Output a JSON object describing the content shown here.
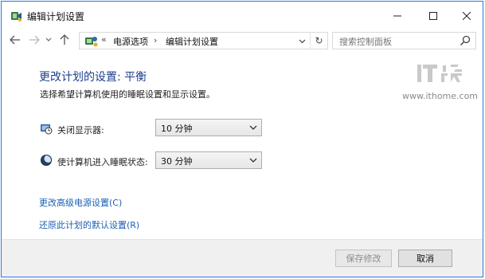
{
  "window": {
    "title": "编辑计划设置",
    "icon": "power-plan-icon"
  },
  "caption_buttons": {
    "minimize": "minimize-icon",
    "maximize": "maximize-icon",
    "close": "close-icon"
  },
  "address": {
    "separator": "«",
    "crumb1": "电源选项",
    "arrow": "›",
    "crumb2": "编辑计划设置",
    "refresh_glyph": "↻"
  },
  "search": {
    "placeholder": "搜索控制面板"
  },
  "main": {
    "title": "更改计划的设置: 平衡",
    "description": "选择希望计算机使用的睡眠设置和显示设置。",
    "settings": [
      {
        "label": "关闭显示器:",
        "value": "10 分钟",
        "icon": "clock-monitor-icon"
      },
      {
        "label": "使计算机进入睡眠状态:",
        "value": "30 分钟",
        "icon": "moon-sleep-icon"
      }
    ],
    "links": {
      "advanced": "更改高级电源设置(C)",
      "restore": "还原此计划的默认设置(R)"
    }
  },
  "watermark": {
    "logo_text": "IT之家",
    "url": "www.ithome.com"
  },
  "footer": {
    "save_label": "保存修改",
    "cancel_label": "取消"
  },
  "colors": {
    "title_blue": "#1e3d8f",
    "link_blue": "#1a5fb4",
    "window_border": "#2b79d8"
  }
}
